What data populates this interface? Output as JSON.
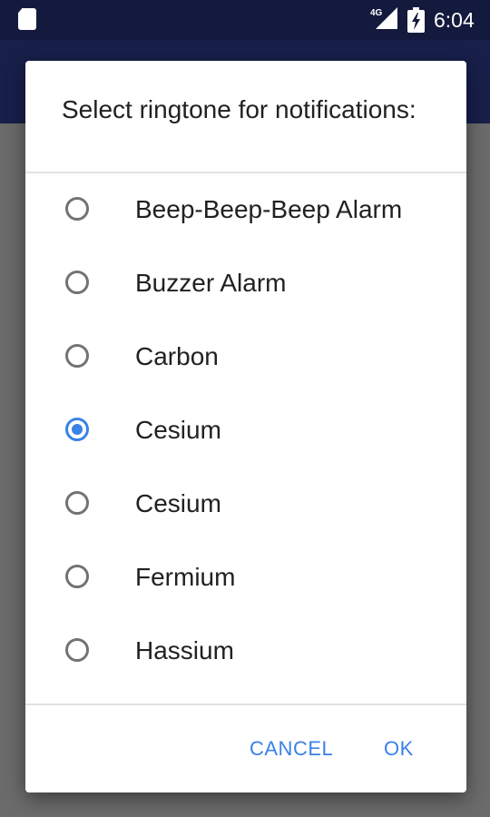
{
  "status_bar": {
    "time": "6:04",
    "network_label": "4G",
    "icons": [
      "sd-card-icon",
      "cellular-signal-icon",
      "battery-charging-icon"
    ]
  },
  "dialog": {
    "title": "Select ringtone for notifications:",
    "options": [
      {
        "label": "Beep-Beep-Beep Alarm",
        "selected": false
      },
      {
        "label": "Buzzer Alarm",
        "selected": false
      },
      {
        "label": "Carbon",
        "selected": false
      },
      {
        "label": "Cesium",
        "selected": true
      },
      {
        "label": "Cesium",
        "selected": false
      },
      {
        "label": "Fermium",
        "selected": false
      },
      {
        "label": "Hassium",
        "selected": false
      }
    ],
    "cancel_label": "CANCEL",
    "ok_label": "OK"
  },
  "colors": {
    "accent": "#3a81e8",
    "status_bar": "#141a3e",
    "app_bar": "#181f4a",
    "scrim": "#6b6b6b"
  }
}
